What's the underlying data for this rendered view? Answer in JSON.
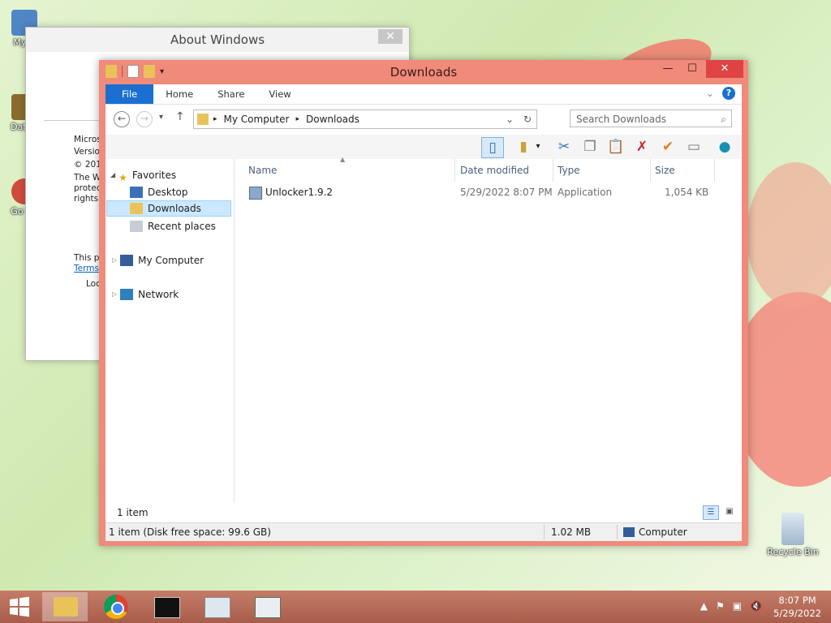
{
  "desktop": {
    "icons": [
      {
        "label": "My C",
        "color": "#4f86c6"
      },
      {
        "label": "DataV",
        "color": "#8a6b2d"
      },
      {
        "label": "Go Ch",
        "color": "#d04b3c"
      }
    ],
    "recycle_bin": "Recycle Bin"
  },
  "about_window": {
    "title": "About Windows",
    "close": "✕",
    "lines": [
      "Microso",
      "Version",
      "© 201",
      "The W",
      "protec",
      "rights i"
    ],
    "note": "This pr",
    "link": "Terms",
    "loc": "Loc"
  },
  "explorer": {
    "title": "Downloads",
    "window_buttons": {
      "minimize": "—",
      "maximize": "☐",
      "close": "✕"
    },
    "ribbon_tabs": [
      "File",
      "Home",
      "Share",
      "View"
    ],
    "help": "?",
    "address": {
      "segments": [
        "My Computer",
        "Downloads"
      ],
      "separator": "▸"
    },
    "search_placeholder": "Search Downloads",
    "nav": {
      "favorites": "Favorites",
      "desktop": "Desktop",
      "downloads": "Downloads",
      "recent": "Recent places",
      "my_computer": "My Computer",
      "network": "Network"
    },
    "columns": {
      "name": "Name",
      "date": "Date modified",
      "type": "Type",
      "size": "Size"
    },
    "files": [
      {
        "name": "Unlocker1.9.2",
        "date": "5/29/2022 8:07 PM",
        "type": "Application",
        "size": "1,054 KB"
      }
    ],
    "item_count": "1 item",
    "status": {
      "left": "1 item (Disk free space: 99.6 GB)",
      "size": "1.02 MB",
      "location": "Computer"
    }
  },
  "taskbar": {
    "time": "8:07 PM",
    "date": "5/29/2022"
  }
}
